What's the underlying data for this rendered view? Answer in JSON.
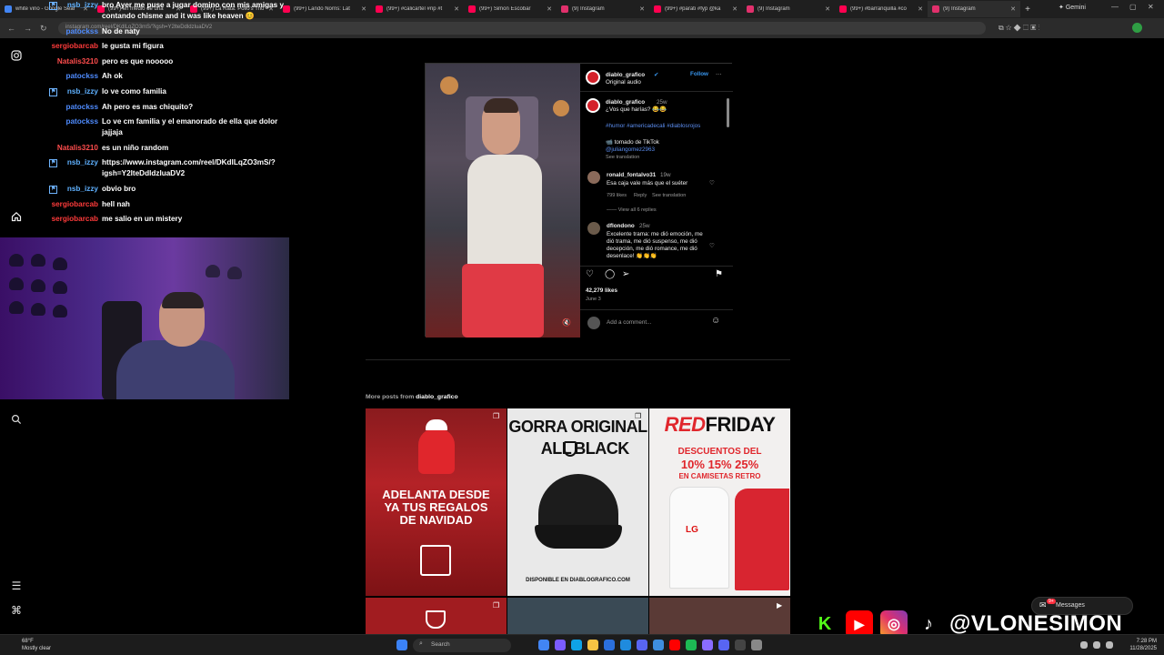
{
  "browser": {
    "tabs": [
      {
        "title": "white vino - Google Sear",
        "color": "#4285f4"
      },
      {
        "title": "(99+) en medio de una",
        "color": "#ff0050"
      },
      {
        "title": "(99+) La Rata: Pollo's Trio",
        "color": "#ff0050"
      },
      {
        "title": "(99+) Lando Norris: Lat",
        "color": "#ff0050"
      },
      {
        "title": "(99+) #calicartel #rip #t",
        "color": "#ff0050"
      },
      {
        "title": "(99+) Simon Escobar",
        "color": "#ff0050"
      },
      {
        "title": "(9) Instagram",
        "color": "#e1306c"
      },
      {
        "title": "(99+) #parati #fyp @ka",
        "color": "#ff0050"
      },
      {
        "title": "(9) Instagram",
        "color": "#e1306c"
      },
      {
        "title": "(99+) #barranquilla #co",
        "color": "#ff0050"
      },
      {
        "title": "(9) Instagram",
        "color": "#e1306c"
      }
    ],
    "gemini_label": "Gemini",
    "url": "instagram.com/reel/DKdlLqZO3mS/?igsh=Y2lteDdldzluaDV2"
  },
  "chat": [
    {
      "user": "nsb_izzy",
      "color": "#5fb1ff",
      "badge": true,
      "msg": "bro Ayer me puse a jugar domino con mis amigas y contando chisme and it was like heaven 😊",
      "lines": 2
    },
    {
      "user": "patockss",
      "color": "#4f8cff",
      "badge": false,
      "msg": "No de naty",
      "lines": 1
    },
    {
      "user": "sergiobarcab",
      "color": "#ff3b3b",
      "badge": false,
      "msg": "le gusta mi figura",
      "lines": 1
    },
    {
      "user": "Natalis3210",
      "color": "#ff4d4d",
      "badge": false,
      "msg": "pero es que nooooo",
      "lines": 1
    },
    {
      "user": "patockss",
      "color": "#4f8cff",
      "badge": false,
      "msg": "Ah ok",
      "lines": 1
    },
    {
      "user": "nsb_izzy",
      "color": "#5fb1ff",
      "badge": true,
      "msg": "lo ve como familia",
      "lines": 1
    },
    {
      "user": "patockss",
      "color": "#4f8cff",
      "badge": false,
      "msg": "Ah pero es mas chiquito?",
      "lines": 1
    },
    {
      "user": "patockss",
      "color": "#4f8cff",
      "badge": false,
      "msg": "Lo ve cm familia y el emanorado de ella que dolor jajjaja",
      "lines": 2
    },
    {
      "user": "Natalis3210",
      "color": "#ff4d4d",
      "badge": false,
      "msg": "es un niño random",
      "lines": 1
    },
    {
      "user": "nsb_izzy",
      "color": "#5fb1ff",
      "badge": true,
      "msg": "https://www.instagram.com/reel/DKdlLqZO3mS/?igsh=Y2lteDdldzluaDV2",
      "lines": 2
    },
    {
      "user": "nsb_izzy",
      "color": "#5fb1ff",
      "badge": true,
      "msg": "obvio bro",
      "lines": 1
    },
    {
      "user": "sergiobarcab",
      "color": "#ff3b3b",
      "badge": false,
      "msg": "hell nah",
      "lines": 1
    },
    {
      "user": "sergiobarcab",
      "color": "#ff3b3b",
      "badge": false,
      "msg": "me salio en un mistery",
      "lines": 1
    }
  ],
  "post": {
    "author": "diablo_grafico",
    "follow_label": "Follow",
    "audio": "Original audio",
    "time": "25w",
    "caption": "¿Vos que harías? 😂😂",
    "hashtags": "#humor #americadecali #diablosrojos",
    "credit_line": "📹 tomado de TikTok",
    "credit_user": "@juliangomez2963",
    "see_translation": "See translation",
    "comments": [
      {
        "user": "ronald_fontalvo31",
        "time": "19w",
        "text": "Esa caja vale más que el suéter",
        "likes": "799 likes",
        "reply": "Reply",
        "translate": "See translation"
      },
      {
        "user": "dflondono",
        "time": "25w",
        "text": "Excelente trama: me dió emoción, me dió trama, me dió suspenso, me dió decepción, me dió romance, me dió desenlace! 👏👏👏"
      }
    ],
    "view_replies": "View all 6 replies",
    "likes": "42,279 likes",
    "date": "June 3",
    "add_comment_placeholder": "Add a comment..."
  },
  "more_posts": {
    "label_prefix": "More posts from",
    "label_user": "diablo_grafico",
    "tiles": [
      {
        "line1": "ADELANTA DESDE",
        "line2": "YA TUS REGALOS",
        "line3": "DE NAVIDAD"
      },
      {
        "line1": "GORRA ORIGINAL",
        "line2": "ALL",
        "line3": "BLACK",
        "footer": "DISPONIBLE EN DIABLOGRAFICO.COM"
      },
      {
        "line1a": "RED",
        "line1b": "FRIDAY",
        "line2": "DESCUENTOS DEL",
        "line3": "10% 15% 25%",
        "line4": "EN CAMISETAS RETRO",
        "shirt_text": "LG"
      }
    ]
  },
  "stream": {
    "handle": "@VLONESIMON",
    "messages_label": "Messages",
    "messages_count": "9+"
  },
  "taskbar": {
    "weather_temp": "68°F",
    "weather_desc": "Mostly clear",
    "search_label": "Search",
    "time": "7:28 PM",
    "date": "11/28/2025"
  }
}
